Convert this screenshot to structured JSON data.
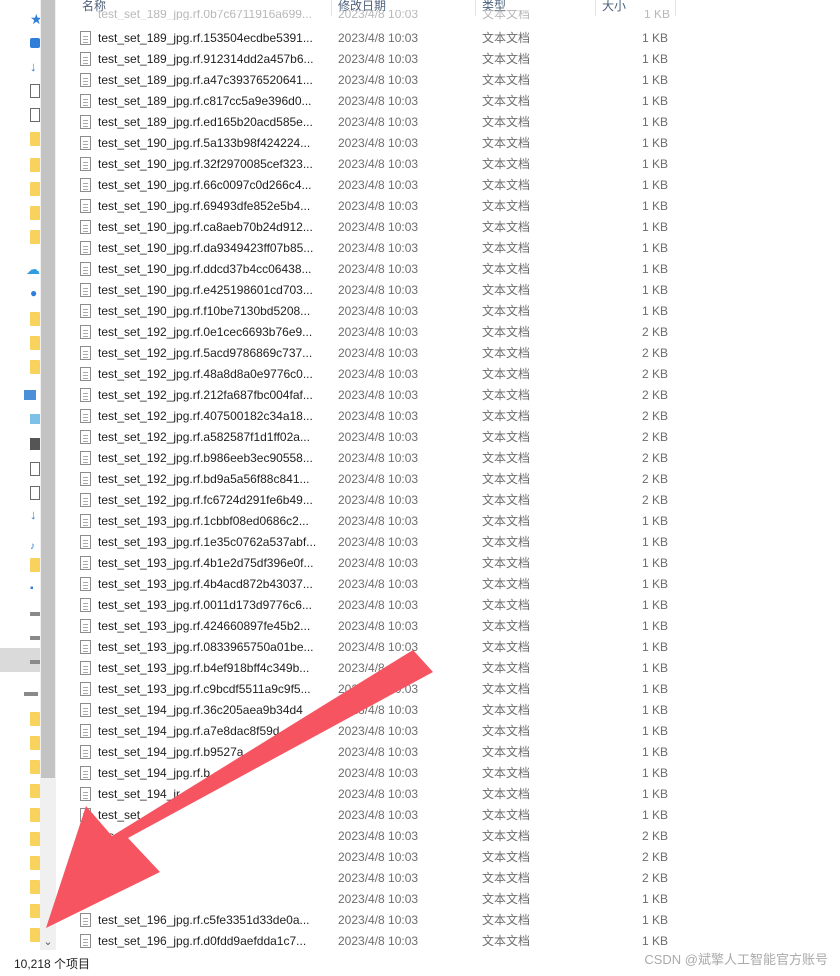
{
  "header": {
    "name": "名称",
    "date": "修改日期",
    "type": "类型",
    "size": "大小",
    "ghost_name": "test_set_189_jpg.rf.0b7c6711916a699...",
    "ghost_date": "2023/4/8 10:03",
    "ghost_type": "文本文档",
    "ghost_size": "1 KB"
  },
  "files": [
    {
      "name": "test_set_189_jpg.rf.153504ecdbe5391...",
      "date": "2023/4/8 10:03",
      "type": "文本文档",
      "size": "1 KB"
    },
    {
      "name": "test_set_189_jpg.rf.912314dd2a457b6...",
      "date": "2023/4/8 10:03",
      "type": "文本文档",
      "size": "1 KB"
    },
    {
      "name": "test_set_189_jpg.rf.a47c39376520641...",
      "date": "2023/4/8 10:03",
      "type": "文本文档",
      "size": "1 KB"
    },
    {
      "name": "test_set_189_jpg.rf.c817cc5a9e396d0...",
      "date": "2023/4/8 10:03",
      "type": "文本文档",
      "size": "1 KB"
    },
    {
      "name": "test_set_189_jpg.rf.ed165b20acd585e...",
      "date": "2023/4/8 10:03",
      "type": "文本文档",
      "size": "1 KB"
    },
    {
      "name": "test_set_190_jpg.rf.5a133b98f424224...",
      "date": "2023/4/8 10:03",
      "type": "文本文档",
      "size": "1 KB"
    },
    {
      "name": "test_set_190_jpg.rf.32f2970085cef323...",
      "date": "2023/4/8 10:03",
      "type": "文本文档",
      "size": "1 KB"
    },
    {
      "name": "test_set_190_jpg.rf.66c0097c0d266c4...",
      "date": "2023/4/8 10:03",
      "type": "文本文档",
      "size": "1 KB"
    },
    {
      "name": "test_set_190_jpg.rf.69493dfe852e5b4...",
      "date": "2023/4/8 10:03",
      "type": "文本文档",
      "size": "1 KB"
    },
    {
      "name": "test_set_190_jpg.rf.ca8aeb70b24d912...",
      "date": "2023/4/8 10:03",
      "type": "文本文档",
      "size": "1 KB"
    },
    {
      "name": "test_set_190_jpg.rf.da9349423ff07b85...",
      "date": "2023/4/8 10:03",
      "type": "文本文档",
      "size": "1 KB"
    },
    {
      "name": "test_set_190_jpg.rf.ddcd37b4cc06438...",
      "date": "2023/4/8 10:03",
      "type": "文本文档",
      "size": "1 KB"
    },
    {
      "name": "test_set_190_jpg.rf.e425198601cd703...",
      "date": "2023/4/8 10:03",
      "type": "文本文档",
      "size": "1 KB"
    },
    {
      "name": "test_set_190_jpg.rf.f10be7130bd5208...",
      "date": "2023/4/8 10:03",
      "type": "文本文档",
      "size": "1 KB"
    },
    {
      "name": "test_set_192_jpg.rf.0e1cec6693b76e9...",
      "date": "2023/4/8 10:03",
      "type": "文本文档",
      "size": "2 KB"
    },
    {
      "name": "test_set_192_jpg.rf.5acd9786869c737...",
      "date": "2023/4/8 10:03",
      "type": "文本文档",
      "size": "2 KB"
    },
    {
      "name": "test_set_192_jpg.rf.48a8d8a0e9776c0...",
      "date": "2023/4/8 10:03",
      "type": "文本文档",
      "size": "2 KB"
    },
    {
      "name": "test_set_192_jpg.rf.212fa687fbc004faf...",
      "date": "2023/4/8 10:03",
      "type": "文本文档",
      "size": "2 KB"
    },
    {
      "name": "test_set_192_jpg.rf.407500182c34a18...",
      "date": "2023/4/8 10:03",
      "type": "文本文档",
      "size": "2 KB"
    },
    {
      "name": "test_set_192_jpg.rf.a582587f1d1ff02a...",
      "date": "2023/4/8 10:03",
      "type": "文本文档",
      "size": "2 KB"
    },
    {
      "name": "test_set_192_jpg.rf.b986eeb3ec90558...",
      "date": "2023/4/8 10:03",
      "type": "文本文档",
      "size": "2 KB"
    },
    {
      "name": "test_set_192_jpg.rf.bd9a5a56f88c841...",
      "date": "2023/4/8 10:03",
      "type": "文本文档",
      "size": "2 KB"
    },
    {
      "name": "test_set_192_jpg.rf.fc6724d291fe6b49...",
      "date": "2023/4/8 10:03",
      "type": "文本文档",
      "size": "2 KB"
    },
    {
      "name": "test_set_193_jpg.rf.1cbbf08ed0686c2...",
      "date": "2023/4/8 10:03",
      "type": "文本文档",
      "size": "1 KB"
    },
    {
      "name": "test_set_193_jpg.rf.1e35c0762a537abf...",
      "date": "2023/4/8 10:03",
      "type": "文本文档",
      "size": "1 KB"
    },
    {
      "name": "test_set_193_jpg.rf.4b1e2d75df396e0f...",
      "date": "2023/4/8 10:03",
      "type": "文本文档",
      "size": "1 KB"
    },
    {
      "name": "test_set_193_jpg.rf.4b4acd872b43037...",
      "date": "2023/4/8 10:03",
      "type": "文本文档",
      "size": "1 KB"
    },
    {
      "name": "test_set_193_jpg.rf.0011d173d9776c6...",
      "date": "2023/4/8 10:03",
      "type": "文本文档",
      "size": "1 KB"
    },
    {
      "name": "test_set_193_jpg.rf.424660897fe45b2...",
      "date": "2023/4/8 10:03",
      "type": "文本文档",
      "size": "1 KB"
    },
    {
      "name": "test_set_193_jpg.rf.0833965750a01be...",
      "date": "2023/4/8 10:03",
      "type": "文本文档",
      "size": "1 KB"
    },
    {
      "name": "test_set_193_jpg.rf.b4ef918bff4c349b...",
      "date": "2023/4/8 10:03",
      "type": "文本文档",
      "size": "1 KB"
    },
    {
      "name": "test_set_193_jpg.rf.c9bcdf5511a9c9f5...",
      "date": "2023/4/8 10:03",
      "type": "文本文档",
      "size": "1 KB"
    },
    {
      "name": "test_set_194_jpg.rf.36c205aea9b34d4",
      "date": "2023/4/8 10:03",
      "type": "文本文档",
      "size": "1 KB"
    },
    {
      "name": "test_set_194_jpg.rf.a7e8dac8f59d",
      "date": "2023/4/8 10:03",
      "type": "文本文档",
      "size": "1 KB"
    },
    {
      "name": "test_set_194_jpg.rf.b9527a",
      "date": "2023/4/8 10:03",
      "type": "文本文档",
      "size": "1 KB"
    },
    {
      "name": "test_set_194_jpg.rf.b",
      "date": "2023/4/8 10:03",
      "type": "文本文档",
      "size": "1 KB"
    },
    {
      "name": "test_set_194_jr",
      "date": "2023/4/8 10:03",
      "type": "文本文档",
      "size": "1 KB"
    },
    {
      "name": "test_set",
      "date": "2023/4/8 10:03",
      "type": "文本文档",
      "size": "1 KB"
    },
    {
      "name": "tes",
      "date": "2023/4/8 10:03",
      "type": "文本文档",
      "size": "2 KB"
    },
    {
      "name": "t",
      "date": "2023/4/8 10:03",
      "type": "文本文档",
      "size": "2 KB"
    },
    {
      "name": "",
      "date": "2023/4/8 10:03",
      "type": "文本文档",
      "size": "2 KB"
    },
    {
      "name": "",
      "date": "2023/4/8 10:03",
      "type": "文本文档",
      "size": "1 KB"
    },
    {
      "name": "test_set_196_jpg.rf.c5fe3351d33de0a...",
      "date": "2023/4/8 10:03",
      "type": "文本文档",
      "size": "1 KB"
    },
    {
      "name": "test_set_196_jpg.rf.d0fdd9aefdda1c7...",
      "date": "2023/4/8 10:03",
      "type": "文本文档",
      "size": "1 KB"
    }
  ],
  "status": {
    "item_count": "10,218 个项目"
  },
  "watermark": "CSDN @斌擎人工智能官方账号",
  "colors": {
    "arrow": "#f75462",
    "folder": "#f7d35d",
    "accent": "#2f7fd8"
  }
}
